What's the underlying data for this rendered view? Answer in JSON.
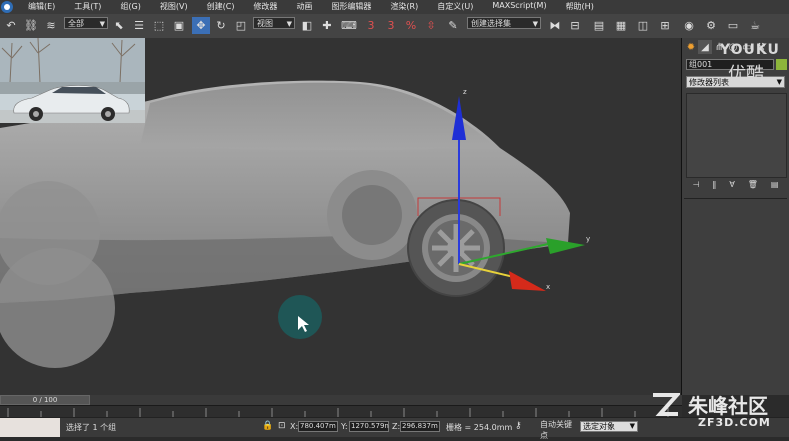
{
  "menu": [
    "编辑(E)",
    "工具(T)",
    "组(G)",
    "视图(V)",
    "创建(C)",
    "修改器",
    "动画",
    "图形编辑器",
    "渲染(R)",
    "自定义(U)",
    "MAXScript(M)",
    "帮助(H)"
  ],
  "toolbar": {
    "selection_filter": "全部",
    "ref_coord": "视图",
    "named_selection": "创建选择集",
    "snap_label": "3",
    "angle_snap_label": "3",
    "percent_snap_label": "%"
  },
  "command_panel": {
    "object_name": "组001",
    "modifier_list": "修改器列表",
    "object_color": "#8db53b"
  },
  "timeline": {
    "slider_label": "0 / 100"
  },
  "status": {
    "prompt": "选择了 1 个组",
    "x_label": "X:",
    "x_value": "780.407m",
    "y_label": "Y:",
    "y_value": "1270.579n",
    "z_label": "Z:",
    "z_value": "296.837m",
    "grid": "栅格 = 254.0mm",
    "auto_key": "自动关键点",
    "selected_dropdown": "选定对象"
  },
  "gizmo_axes": {
    "x": "x",
    "y": "y",
    "z": "z"
  },
  "watermark": {
    "youku": "YOUKU",
    "youku_cn": "优酷",
    "site_cn": "朱峰社区",
    "site_url": "ZF3D.COM"
  }
}
